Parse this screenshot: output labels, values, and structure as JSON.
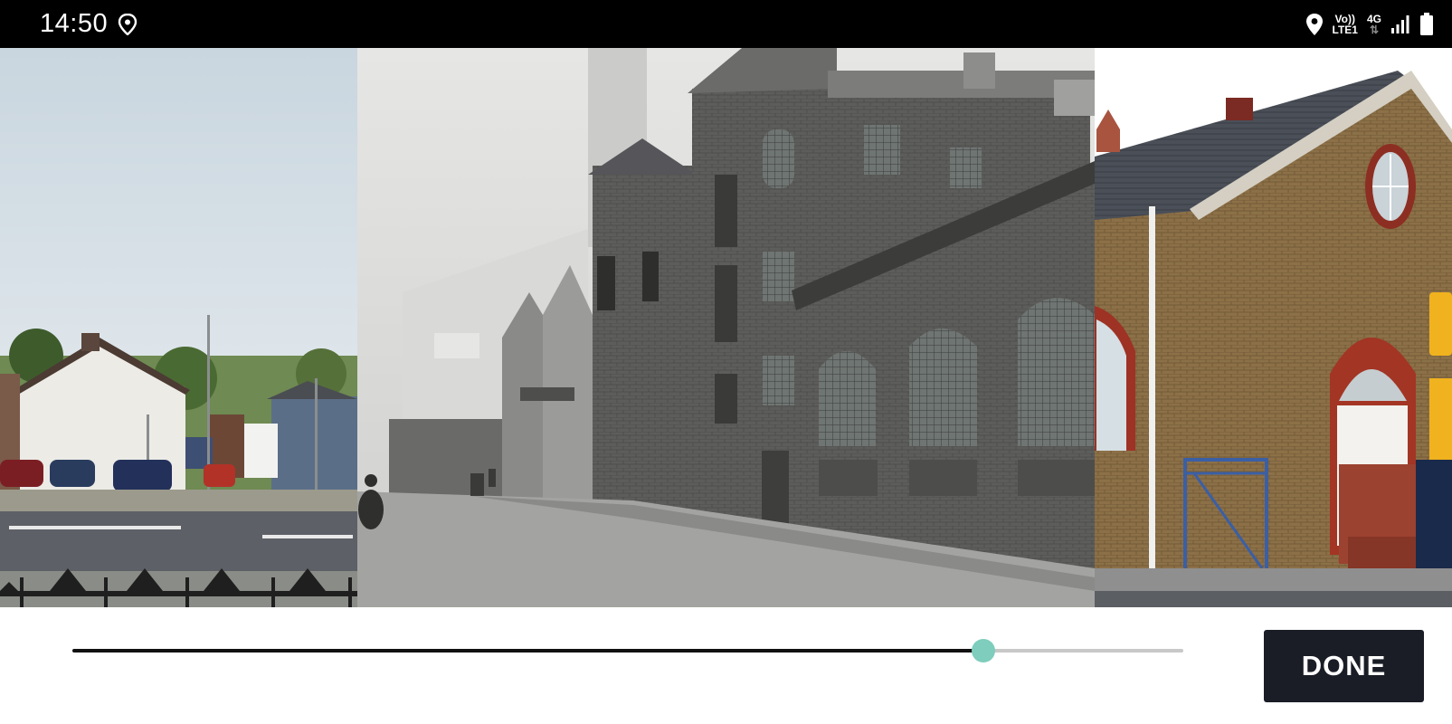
{
  "status_bar": {
    "time": "14:50",
    "left_icon": "location-pin-badge-icon",
    "network_line1": "Vo))",
    "network_line2": "LTE1",
    "network_type": "4G",
    "icons": [
      "location-pin-icon",
      "signal-icon",
      "battery-icon"
    ]
  },
  "photo": {
    "description_icon": "photo-comparison-image"
  },
  "overlay_slider": {
    "value": 0.82,
    "accent_color": "#7ecdbd"
  },
  "actions": {
    "done_label": "DONE"
  },
  "colors": {
    "status_bar": "#000000",
    "button_bg": "#1a1d26",
    "slider_thumb": "#7ecdbd"
  }
}
